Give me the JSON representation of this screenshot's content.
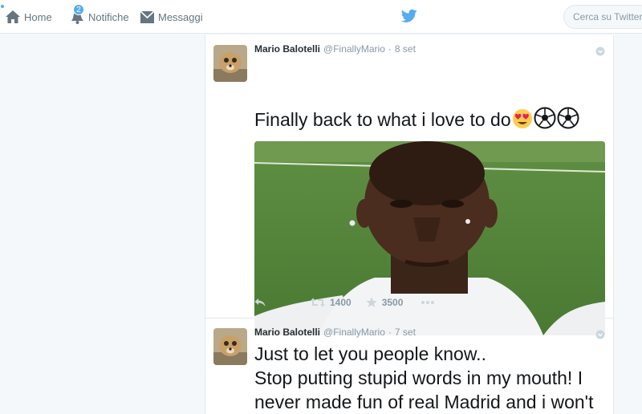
{
  "nav": {
    "home_label": "Home",
    "notifications_label": "Notifiche",
    "notifications_count": "2",
    "messages_label": "Messaggi",
    "search_placeholder": "Cerca su Twitter"
  },
  "tweets": [
    {
      "name": "Mario Balotelli",
      "handle": "@FinallyMario",
      "time": "8 set",
      "text": "Finally back to what i love to do",
      "emojis": [
        "heart-eyes-emoji",
        "soccer-ball-emoji",
        "soccer-ball-emoji"
      ],
      "retweets": "1400",
      "favorites": "3500"
    },
    {
      "name": "Mario Balotelli",
      "handle": "@FinallyMario",
      "time": "7 set",
      "text": "Just to let you people know..\nStop putting stupid words in my mouth! I never made fun of real Madrid and i won't"
    }
  ],
  "colors": {
    "accent": "#55acee",
    "muted": "#8899a6",
    "text": "#14171a"
  }
}
